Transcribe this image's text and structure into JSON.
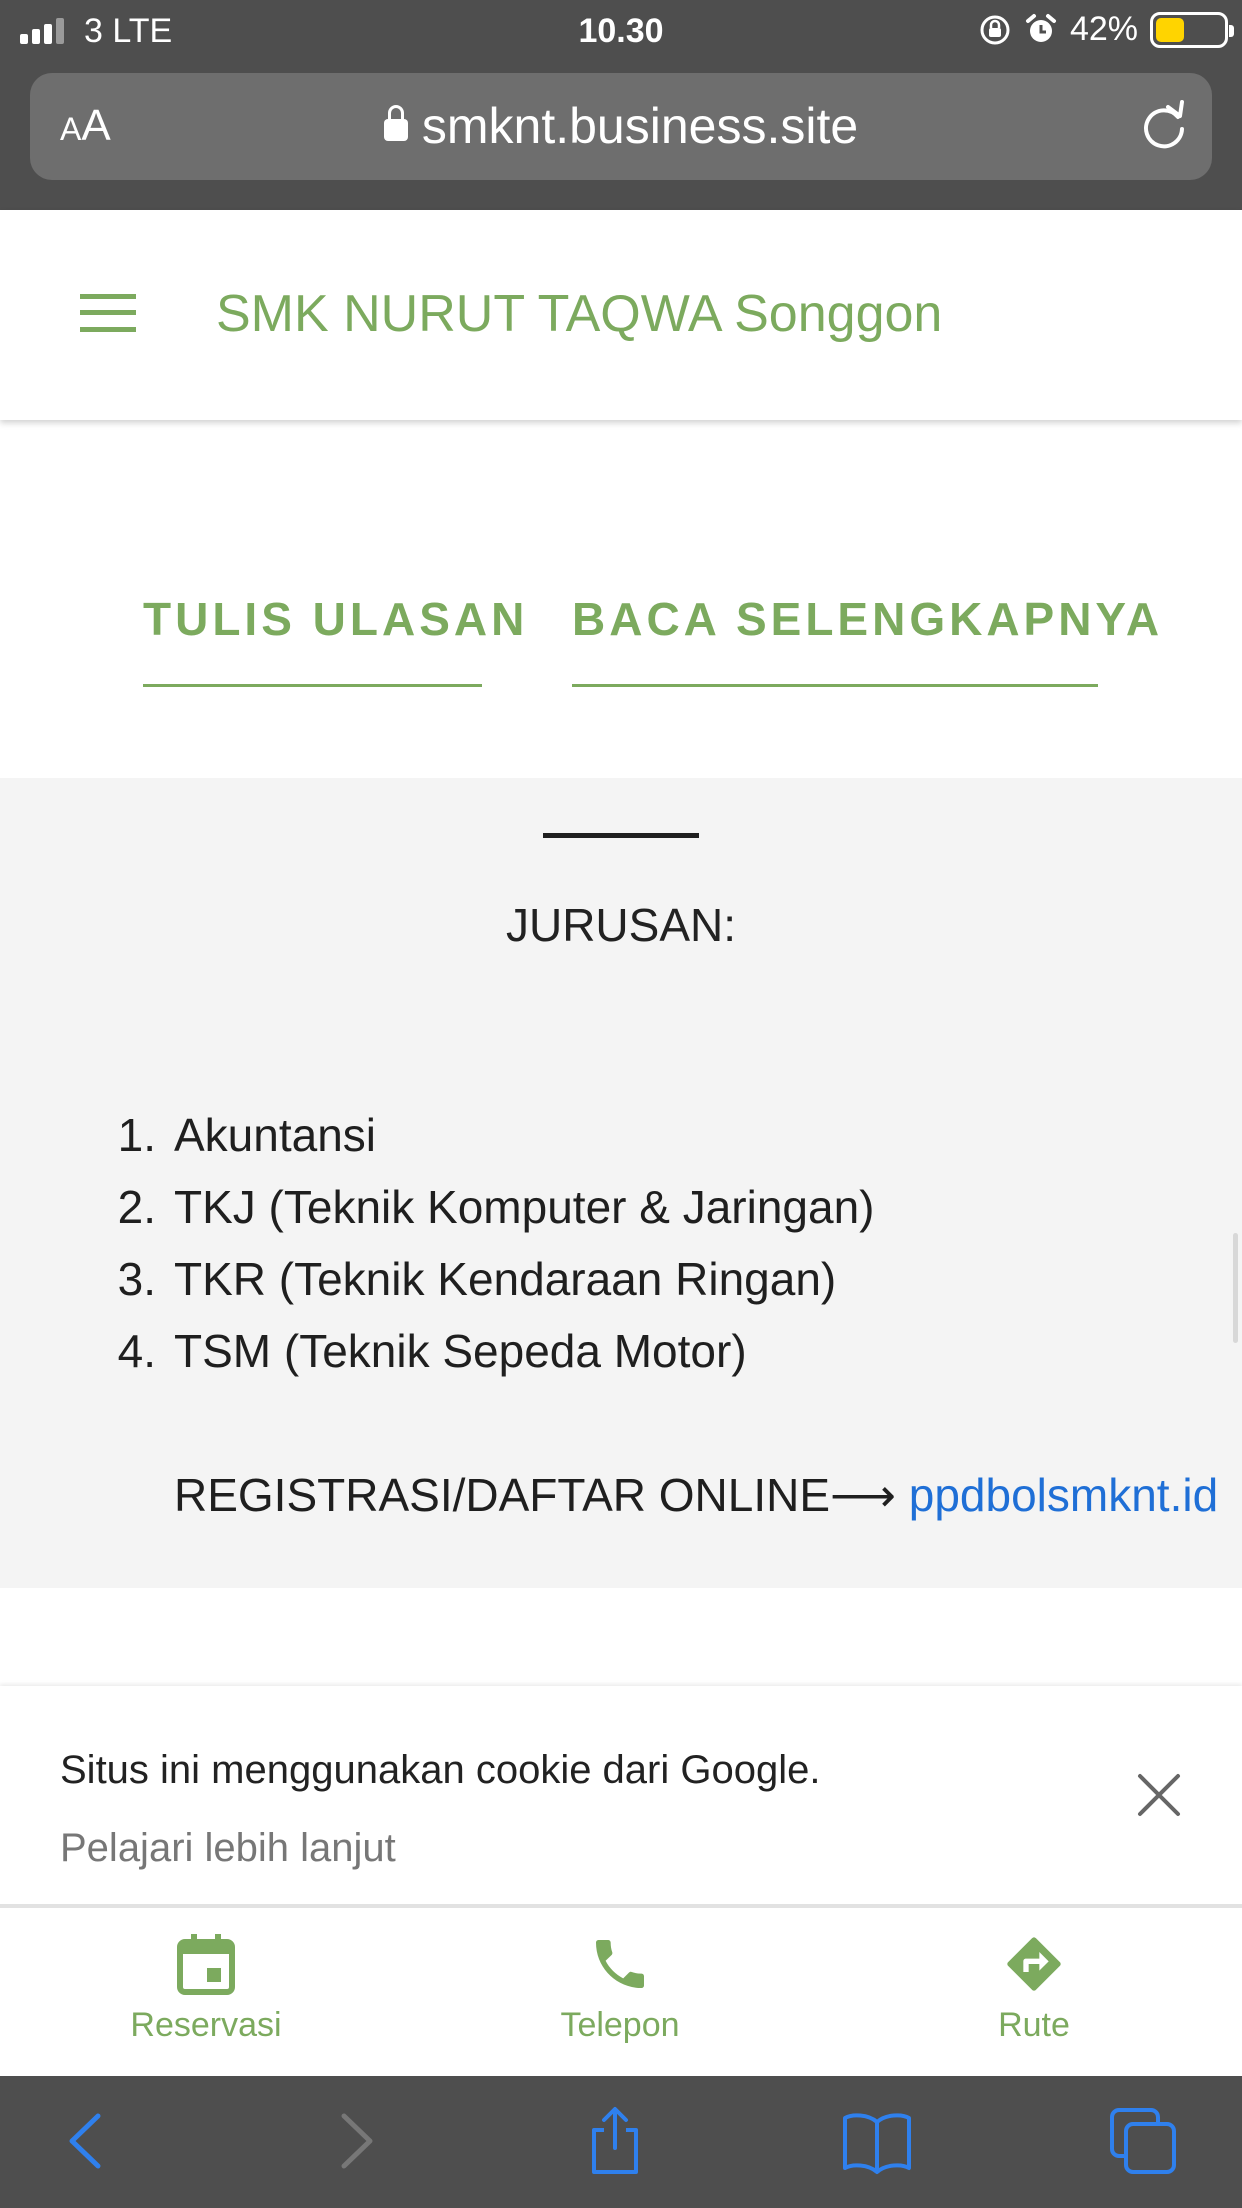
{
  "status_bar": {
    "carrier": "3  LTE",
    "time": "10.30",
    "battery_percent": "42%",
    "battery_level": 0.42
  },
  "browser": {
    "text_size_label_small": "A",
    "text_size_label_large": "A",
    "url": "smknt.business.site"
  },
  "site": {
    "title": "SMK NURUT TAQWA Songgon",
    "accent_color": "#7caa5e",
    "cta": {
      "write_review": "TULIS ULASAN",
      "read_more": "BACA SELENGKAPNYA"
    }
  },
  "section": {
    "title": "JURUSAN:",
    "items": [
      {
        "num": "1.",
        "label": "Akuntansi"
      },
      {
        "num": "2.",
        "label": "TKJ (Teknik Komputer & Jaringan)"
      },
      {
        "num": "3.",
        "label": "TKR (Teknik Kendaraan Ringan)"
      },
      {
        "num": "4.",
        "label": "TSM (Teknik Sepeda Motor)"
      }
    ],
    "registration_text": "REGISTRASI/DAFTAR ONLINE",
    "registration_arrow": "⟶ ",
    "registration_link": "ppdbolsmknt.id",
    "link_color": "#1f6fd6"
  },
  "cookie_notice": {
    "message": "Situs ini menggunakan cookie dari Google.",
    "learn_more": "Pelajari lebih lanjut"
  },
  "action_bar": {
    "reservation": "Reservasi",
    "phone": "Telepon",
    "route": "Rute"
  },
  "icons": {
    "menu": "hamburger-icon",
    "lock": "lock-icon",
    "reload": "reload-icon",
    "close": "close-icon",
    "reservation": "calendar-icon",
    "phone": "phone-icon",
    "route": "directions-icon",
    "back": "chevron-left-icon",
    "forward": "chevron-right-icon",
    "share": "share-icon",
    "bookmarks": "book-icon",
    "tabs": "tabs-icon"
  }
}
